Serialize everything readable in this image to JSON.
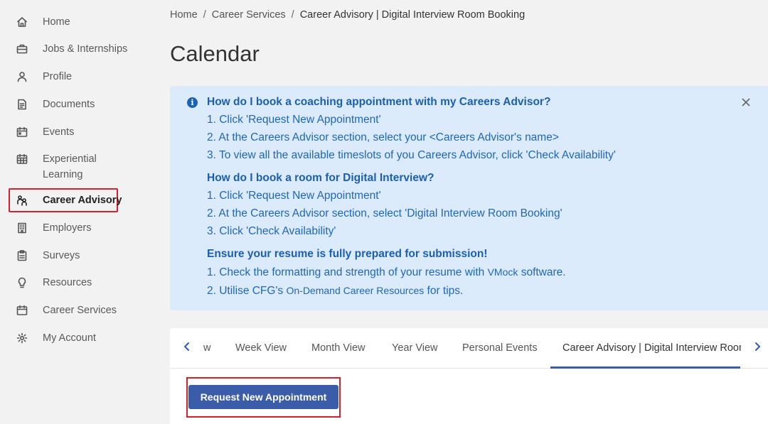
{
  "sidebar": {
    "items": [
      {
        "label": "Home"
      },
      {
        "label": "Jobs & Internships"
      },
      {
        "label": "Profile"
      },
      {
        "label": "Documents"
      },
      {
        "label": "Events"
      },
      {
        "label": "Experiential"
      },
      {
        "label": "Career Advisory"
      },
      {
        "label": "Employers"
      },
      {
        "label": "Surveys"
      },
      {
        "label": "Resources"
      },
      {
        "label": "Career Services"
      },
      {
        "label": "My Account"
      }
    ],
    "experiential_line2": "Learning"
  },
  "breadcrumb": {
    "home": "Home",
    "career_services": "Career Services",
    "current": "Career Advisory | Digital Interview Room Booking",
    "separator": "/"
  },
  "page_title": "Calendar",
  "info": {
    "sections": [
      {
        "heading": "How do I book a coaching appointment with my Careers Advisor?",
        "lines": [
          "1. Click 'Request New Appointment'",
          "2. At the Careers Advisor section, select your <Careers Advisor's name>",
          "3. To view all the available timeslots of you Careers Advisor, click 'Check Availability'"
        ]
      },
      {
        "heading": "How do I book a room for Digital Interview?",
        "lines": [
          "1. Click 'Request New Appointment'",
          "2. At the Careers Advisor section, select 'Digital Interview Room Booking'",
          "3. Click 'Check Availability'"
        ]
      },
      {
        "heading": "Ensure your resume is fully prepared for submission!",
        "resume_line1_a": "1. Check the formatting and strength of your resume with ",
        "resume_line1_b": "VMock",
        "resume_line1_c": " software.",
        "resume_line2_a": "2. Utilise CFG's ",
        "resume_line2_b": "On-Demand Career Resources",
        "resume_line2_c": " for tips."
      }
    ]
  },
  "tabs": {
    "items": [
      "w",
      "Week View",
      "Month View",
      "Year View",
      "Personal Events",
      "Career Advisory | Digital Interview Room Booking"
    ],
    "active_index": 5
  },
  "request_button": "Request New Appointment",
  "colors": {
    "accent": "#3b5ca8",
    "info_bg": "#dcebfb",
    "info_text": "#1a62b8",
    "highlight_border": "#d5202f"
  }
}
